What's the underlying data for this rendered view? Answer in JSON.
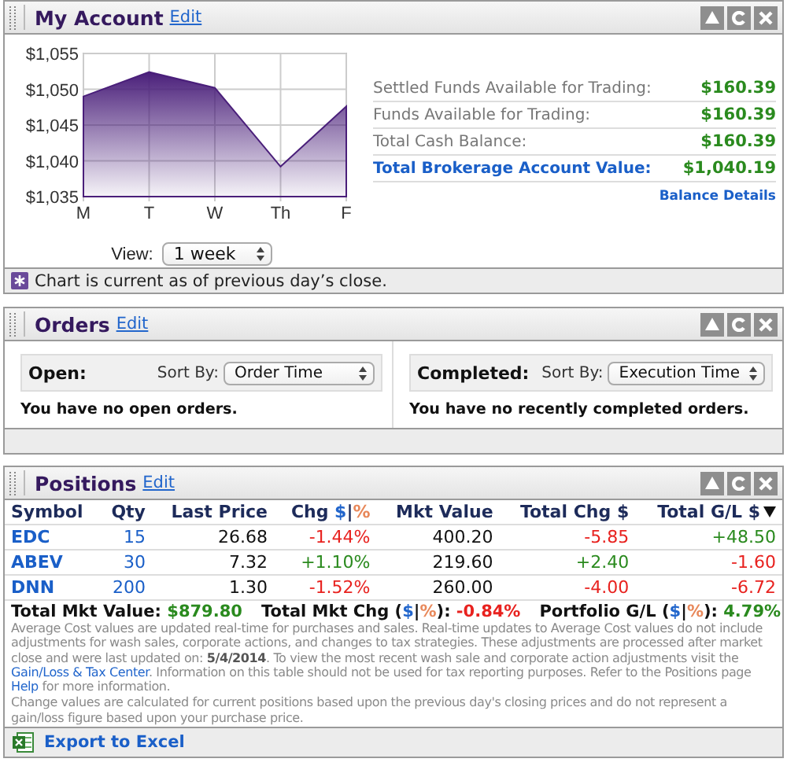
{
  "account": {
    "title": "My Account",
    "edit": "Edit",
    "chart_data": {
      "type": "area",
      "grid": true,
      "categories": [
        "M",
        "T",
        "W",
        "Th",
        "F"
      ],
      "series": [
        {
          "color": "#4a1f7a",
          "values": [
            1049,
            1052.4,
            1050.2,
            1039.2,
            1047.6
          ]
        }
      ],
      "ylim": [
        1035,
        1055
      ],
      "yticks": [
        {
          "value": 1035,
          "label": "$1,035"
        },
        {
          "value": 1040,
          "label": "$1,040"
        },
        {
          "value": 1045,
          "label": "$1,045"
        },
        {
          "value": 1050,
          "label": "$1,050"
        },
        {
          "value": 1055,
          "label": "$1,055"
        }
      ]
    },
    "view_label": "View:",
    "view_value": "1 week",
    "balances": [
      {
        "label": "Settled Funds Available for Trading:",
        "value": "$160.39",
        "kind": "plain"
      },
      {
        "label": "Funds Available for Trading:",
        "value": "$160.39",
        "kind": "plain"
      },
      {
        "label": "Total Cash Balance:",
        "value": "$160.39",
        "kind": "plain"
      },
      {
        "label": "Total Brokerage Account Value:",
        "value": "$1,040.19",
        "kind": "total"
      }
    ],
    "balance_details": "Balance Details",
    "note": "Chart is current as of previous day’s close."
  },
  "orders": {
    "title": "Orders",
    "edit": "Edit",
    "sections": [
      {
        "label": "Open:",
        "sort_label": "Sort By:",
        "sort_value": "Order Time",
        "message": "You have no open orders."
      },
      {
        "label": "Completed:",
        "sort_label": "Sort By:",
        "sort_value": "Execution Time",
        "message": "You have no recently completed orders."
      }
    ]
  },
  "positions": {
    "title": "Positions",
    "edit": "Edit",
    "columns": [
      {
        "parts": [
          {
            "text": "Symbol"
          }
        ],
        "sorted": false
      },
      {
        "parts": [
          {
            "text": "Qty"
          }
        ],
        "sorted": false
      },
      {
        "parts": [
          {
            "text": "Last Price"
          }
        ],
        "sorted": false
      },
      {
        "parts": [
          {
            "text": "Chg "
          },
          {
            "text": "$",
            "kind": "dollar"
          },
          {
            "text": "|"
          },
          {
            "text": "%",
            "kind": "percent"
          }
        ],
        "sorted": false
      },
      {
        "parts": [
          {
            "text": "Mkt Value"
          }
        ],
        "sorted": false
      },
      {
        "parts": [
          {
            "text": "Total Chg $"
          }
        ],
        "sorted": false
      },
      {
        "parts": [
          {
            "text": "Total G/L $"
          }
        ],
        "sorted": true
      }
    ],
    "rows": [
      {
        "cells": [
          {
            "text": "EDC",
            "kind": "symbol"
          },
          {
            "text": "15",
            "kind": "qty"
          },
          {
            "text": "26.68",
            "kind": "number"
          },
          {
            "text": "-1.44%",
            "kind": "change",
            "color": "#e8221f"
          },
          {
            "text": "400.20",
            "kind": "number"
          },
          {
            "text": "-5.85",
            "kind": "change",
            "color": "#e8221f"
          },
          {
            "text": "+48.50",
            "kind": "change",
            "color": "#2a8a1e"
          }
        ]
      },
      {
        "cells": [
          {
            "text": "ABEV",
            "kind": "symbol"
          },
          {
            "text": "30",
            "kind": "qty"
          },
          {
            "text": "7.32",
            "kind": "number"
          },
          {
            "text": "+1.10%",
            "kind": "change",
            "color": "#2a8a1e"
          },
          {
            "text": "219.60",
            "kind": "number"
          },
          {
            "text": "+2.40",
            "kind": "change",
            "color": "#2a8a1e"
          },
          {
            "text": "-1.60",
            "kind": "change",
            "color": "#e8221f"
          }
        ]
      },
      {
        "cells": [
          {
            "text": "DNN",
            "kind": "symbol"
          },
          {
            "text": "200",
            "kind": "qty"
          },
          {
            "text": "1.30",
            "kind": "number"
          },
          {
            "text": "-1.52%",
            "kind": "change",
            "color": "#e8221f"
          },
          {
            "text": "260.00",
            "kind": "number"
          },
          {
            "text": "-4.00",
            "kind": "change",
            "color": "#e8221f"
          },
          {
            "text": "-6.72",
            "kind": "change",
            "color": "#e8221f"
          }
        ]
      }
    ],
    "totals": [
      {
        "parts": [
          {
            "text": "Total Mkt Value:"
          }
        ],
        "value": "$879.80",
        "color": "#2a8a1e"
      },
      {
        "parts": [
          {
            "text": "Total Mkt Chg ("
          },
          {
            "text": "$",
            "kind": "dollar"
          },
          {
            "text": "|"
          },
          {
            "text": "%",
            "kind": "percent"
          },
          {
            "text": "):"
          }
        ],
        "value": "-0.84%",
        "color": "#e8221f"
      },
      {
        "parts": [
          {
            "text": "Portfolio G/L ("
          },
          {
            "text": "$",
            "kind": "dollar"
          },
          {
            "text": "|"
          },
          {
            "text": "%",
            "kind": "percent"
          },
          {
            "text": "):"
          }
        ],
        "value": "4.79%",
        "color": "#2a8a1e"
      }
    ],
    "notes": [
      {
        "parts": [
          {
            "text": "Average Cost values are updated real-time for purchases and sales. Real-time updates to Average Cost values do not include adjustments for wash sales, corporate actions, and changes to tax strategies. These adjustments are processed after market close and were last updated on: "
          },
          {
            "text": "5/4/2014",
            "kind": "bold"
          },
          {
            "text": ". To view the most recent wash sale and corporate action adjustments visit the "
          },
          {
            "text": "Gain/Loss & Tax Center",
            "kind": "link"
          },
          {
            "text": ". Information on this table should not be used for tax reporting purposes. Refer to the Positions page "
          },
          {
            "text": "Help",
            "kind": "link"
          },
          {
            "text": " for more information."
          }
        ]
      },
      {
        "parts": [
          {
            "text": "Change values are calculated for current positions based upon the previous day's closing prices and do not represent a gain/loss figure based upon your purchase price."
          }
        ]
      }
    ],
    "export": "Export to Excel"
  }
}
